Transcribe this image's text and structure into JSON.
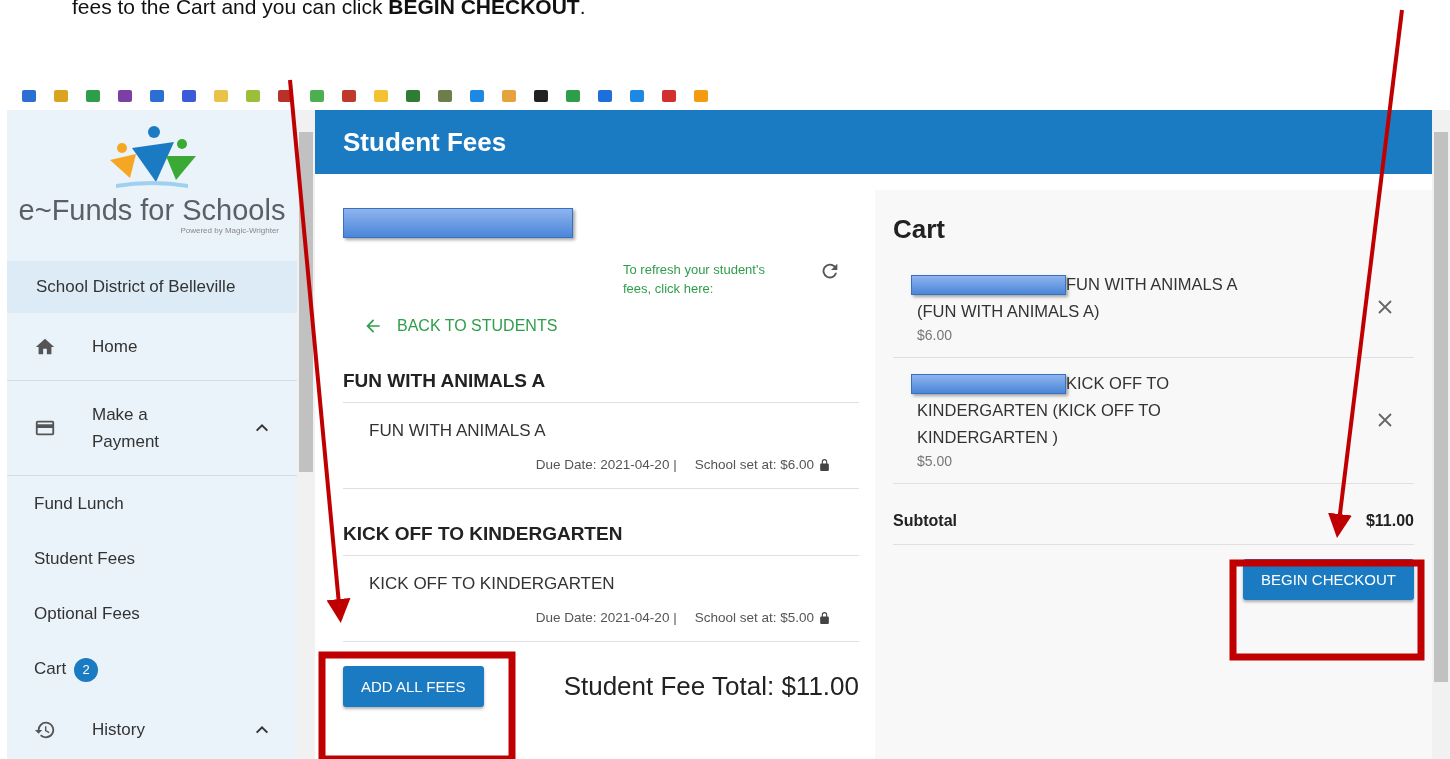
{
  "instruction": "fees to the Cart and you can click **BEGIN CHECKOUT**.",
  "bookmarks": [
    {
      "color": "#2a6fd1"
    },
    {
      "color": "#d9a521"
    },
    {
      "color": "#2e9e4a"
    },
    {
      "color": "#7b3fa6"
    },
    {
      "color": "#2a6fd1"
    },
    {
      "color": "#3b5bdb"
    },
    {
      "color": "#e8c24a"
    },
    {
      "color": "#9bbf3a"
    },
    {
      "color": "#b8322c"
    },
    {
      "color": "#4caf50"
    },
    {
      "color": "#c0392b"
    },
    {
      "color": "#f2c230"
    },
    {
      "color": "#2e7d32"
    },
    {
      "color": "#6d7d4c"
    },
    {
      "color": "#1e88e5"
    },
    {
      "color": "#e6a23c"
    },
    {
      "color": "#222222"
    },
    {
      "color": "#2e9e4a"
    },
    {
      "color": "#1e6fd9"
    },
    {
      "color": "#1e88e5"
    },
    {
      "color": "#d32f2f"
    },
    {
      "color": "#f39c12"
    }
  ],
  "sidebar": {
    "logo": {
      "title": "e~Funds for Schools",
      "tagline": "Powered by Magic-Wrighter"
    },
    "district": "School District of Belleville",
    "items": [
      {
        "kind": "nav",
        "label": "Home"
      },
      {
        "kind": "group",
        "label": "Make a Payment",
        "expanded": true
      },
      {
        "kind": "sub",
        "label": "Fund Lunch"
      },
      {
        "kind": "sub",
        "label": "Student Fees"
      },
      {
        "kind": "sub",
        "label": "Optional Fees"
      },
      {
        "kind": "sub",
        "label": "Cart",
        "badge": "2"
      },
      {
        "kind": "group",
        "label": "History",
        "expanded": true
      }
    ]
  },
  "page": {
    "title": "Student Fees",
    "refresh_hint": "To refresh your student's fees, click here:",
    "back_link": "BACK TO STUDENTS",
    "fees": [
      {
        "heading": "FUN WITH ANIMALS A",
        "item": "FUN WITH ANIMALS A",
        "due": "Due Date: 2021-04-20 |",
        "price": "School set at: $6.00"
      },
      {
        "heading": "KICK OFF TO KINDERGARTEN",
        "item": "KICK OFF TO KINDERGARTEN",
        "due": "Due Date: 2021-04-20 |",
        "price": "School set at: $5.00"
      }
    ],
    "add_button": "ADD ALL FEES",
    "total": "Student Fee Total: $11.00"
  },
  "cart": {
    "title": "Cart",
    "items": [
      {
        "name_start": "FUN WITH ANIMALS A",
        "name_rest": "(FUN WITH ANIMALS A)",
        "price": "$6.00"
      },
      {
        "name_start": "KICK OFF TO",
        "name_rest": "KINDERGARTEN (KICK OFF TO KINDERGARTEN )",
        "price": "$5.00"
      }
    ],
    "subtotal_label": "Subtotal",
    "subtotal": "$11.00",
    "checkout_button": "BEGIN CHECKOUT"
  }
}
